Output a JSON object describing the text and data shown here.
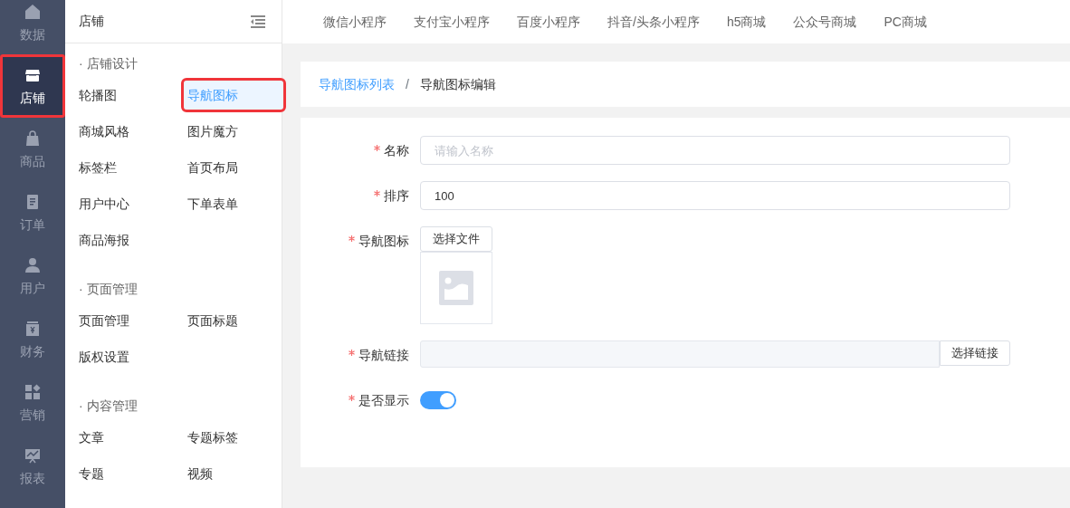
{
  "rail": [
    {
      "label": "数据",
      "selected": false,
      "highlighted": false
    },
    {
      "label": "店铺",
      "selected": true,
      "highlighted": true
    },
    {
      "label": "商品",
      "selected": false,
      "highlighted": false
    },
    {
      "label": "订单",
      "selected": false,
      "highlighted": false
    },
    {
      "label": "用户",
      "selected": false,
      "highlighted": false
    },
    {
      "label": "财务",
      "selected": false,
      "highlighted": false
    },
    {
      "label": "营销",
      "selected": false,
      "highlighted": false
    },
    {
      "label": "报表",
      "selected": false,
      "highlighted": false
    }
  ],
  "panel": {
    "title": "店铺",
    "sections": [
      {
        "title": "· 店铺设计",
        "items": [
          {
            "label": "轮播图",
            "selected": false,
            "highlighted": false
          },
          {
            "label": "导航图标",
            "selected": true,
            "highlighted": true
          },
          {
            "label": "商城风格",
            "selected": false,
            "highlighted": false
          },
          {
            "label": "图片魔方",
            "selected": false,
            "highlighted": false
          },
          {
            "label": "标签栏",
            "selected": false,
            "highlighted": false
          },
          {
            "label": "首页布局",
            "selected": false,
            "highlighted": false
          },
          {
            "label": "用户中心",
            "selected": false,
            "highlighted": false
          },
          {
            "label": "下单表单",
            "selected": false,
            "highlighted": false
          },
          {
            "label": "商品海报",
            "selected": false,
            "highlighted": false
          }
        ]
      },
      {
        "title": "· 页面管理",
        "items": [
          {
            "label": "页面管理",
            "selected": false,
            "highlighted": false
          },
          {
            "label": "页面标题",
            "selected": false,
            "highlighted": false
          },
          {
            "label": "版权设置",
            "selected": false,
            "highlighted": false
          }
        ]
      },
      {
        "title": "· 内容管理",
        "items": [
          {
            "label": "文章",
            "selected": false,
            "highlighted": false
          },
          {
            "label": "专题标签",
            "selected": false,
            "highlighted": false
          },
          {
            "label": "专题",
            "selected": false,
            "highlighted": false
          },
          {
            "label": "视频",
            "selected": false,
            "highlighted": false
          }
        ]
      }
    ]
  },
  "top_tabs": [
    "微信小程序",
    "支付宝小程序",
    "百度小程序",
    "抖音/头条小程序",
    "h5商城",
    "公众号商城",
    "PC商城"
  ],
  "breadcrumb": {
    "separator": "/",
    "items": [
      {
        "label": "导航图标列表",
        "kind": "link"
      },
      {
        "label": "导航图标编辑",
        "kind": "current"
      }
    ]
  },
  "form": {
    "fields": [
      {
        "label": "名称",
        "required": true,
        "kind": "text",
        "placeholder": "请输入名称"
      },
      {
        "label": "排序",
        "required": true,
        "kind": "text",
        "value": "100"
      },
      {
        "label": "导航图标",
        "required": true,
        "kind": "image",
        "button": "选择文件"
      },
      {
        "label": "导航链接",
        "required": true,
        "kind": "link",
        "button": "选择链接"
      },
      {
        "label": "是否显示",
        "required": true,
        "kind": "switch",
        "on": true
      }
    ]
  }
}
